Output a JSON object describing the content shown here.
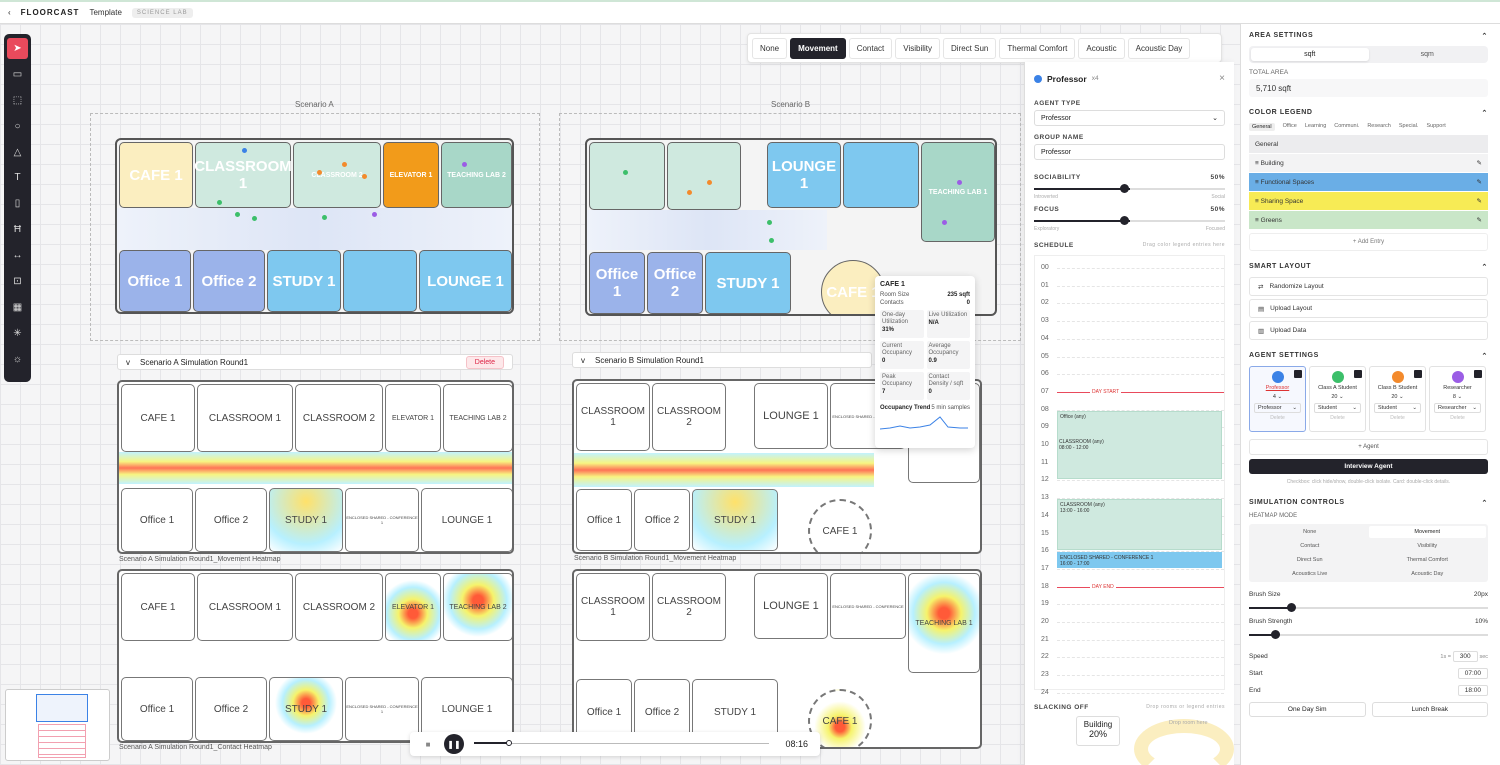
{
  "app": {
    "brand": "FLOORCAST",
    "template": "Template",
    "badge": "SCIENCE LAB"
  },
  "tools": [
    "cursor-icon",
    "rectangle-icon",
    "dashed-rect-icon",
    "circle-icon",
    "triangle-icon",
    "text-icon",
    "door-icon",
    "stairs-icon",
    "dimension-icon",
    "area-select-icon",
    "grid-icon",
    "sparkle-icon",
    "sun-icon"
  ],
  "modes": [
    "None",
    "Movement",
    "Contact",
    "Visibility",
    "Direct Sun",
    "Thermal Comfort",
    "Acoustic",
    "Acoustic Day"
  ],
  "active_mode": "Movement",
  "scenario_a": {
    "label": "Scenario A",
    "rooms": [
      "CAFE 1",
      "CLASSROOM 1",
      "CLASSROOM 2",
      "ELEVATOR 1",
      "TEACHING LAB 2",
      "Office 1",
      "Office 2",
      "STUDY 1",
      "LOUNGE 1"
    ],
    "sim_title": "Scenario A Simulation Round1",
    "delete": "Delete",
    "heatmap_caption": "Scenario A Simulation Round1_Movement Heatmap",
    "contact_caption": "Scenario A Simulation Round1_Contact Heatmap",
    "heat_rooms": [
      "CAFE 1",
      "CLASSROOM 1",
      "CLASSROOM 2",
      "ELEVATOR 1",
      "TEACHING LAB 2",
      "Office 1",
      "Office 2",
      "STUDY 1",
      "ENCLOSED SHARED - CONFERENCE 1",
      "LOUNGE 1"
    ]
  },
  "scenario_b": {
    "label": "Scenario B",
    "rooms": [
      "LOUNGE 1",
      "TEACHING LAB 1",
      "Office 1",
      "Office 2",
      "STUDY 1",
      "CAFE 1"
    ],
    "sim_title": "Scenario B Simulation Round1",
    "heatmap_caption": "Scenario B Simulation Round1_Movement Heatmap",
    "heat_rooms": [
      "CLASSROOM 1",
      "CLASSROOM 2",
      "LOUNGE 1",
      "ENCLOSED SHARED - CONFERENCE",
      "TEACHING LAB 1",
      "Office 1",
      "Office 2",
      "STUDY 1",
      "CAFE 1"
    ]
  },
  "tooltip": {
    "title": "CAFE 1",
    "room_size_label": "Room Size",
    "room_size": "235 sqft",
    "contacts_label": "Contacts",
    "contacts": "0",
    "stats": [
      {
        "label": "One-day Utilization",
        "value": "31%"
      },
      {
        "label": "Live Utilization",
        "value": "N/A"
      },
      {
        "label": "Current Occupancy",
        "value": "0"
      },
      {
        "label": "Average Occupancy",
        "value": "0.9"
      },
      {
        "label": "Peak Occupancy",
        "value": "7"
      },
      {
        "label": "Contact Density / sqft",
        "value": "0"
      }
    ],
    "trend_label": "Occupancy Trend",
    "trend_note": "5 min samples"
  },
  "agent_panel": {
    "name": "Professor",
    "count": "x4",
    "agent_type_label": "AGENT TYPE",
    "agent_type": "Professor",
    "group_label": "GROUP NAME",
    "group": "Professor",
    "sociability_label": "SOCIABILITY",
    "sociability": "50%",
    "soc_left": "Introverted",
    "soc_right": "Social",
    "focus_label": "FOCUS",
    "focus": "50%",
    "focus_left": "Exploratory",
    "focus_right": "Focused",
    "schedule_label": "SCHEDULE",
    "schedule_hint": "Drag color legend entries here",
    "hours": [
      "00",
      "01",
      "02",
      "03",
      "04",
      "05",
      "06",
      "07",
      "08",
      "09",
      "10",
      "11",
      "12",
      "13",
      "14",
      "15",
      "16",
      "17",
      "18",
      "19",
      "20",
      "21",
      "22",
      "23",
      "24"
    ],
    "day_start": "DAY START",
    "day_end": "DAY END",
    "blocks": [
      {
        "title": "Office (any)",
        "time": ""
      },
      {
        "title": "CLASSROOM (any)",
        "time": "08:00 - 12:00"
      },
      {
        "title": "CLASSROOM (any)",
        "time": "13:00 - 16:00"
      },
      {
        "title": "ENCLOSED SHARED - CONFERENCE 1",
        "time": "16:00 - 17:00"
      }
    ],
    "slacking_label": "SLACKING OFF",
    "slacking_hint": "Drop rooms or legend entries",
    "drop_hint": "Drop room here",
    "slack_room": "Building",
    "slack_value": "20%"
  },
  "settings": {
    "area_title": "AREA SETTINGS",
    "units": [
      "sqft",
      "sqm"
    ],
    "total_label": "TOTAL AREA",
    "total": "5,710 sqft",
    "legend_title": "COLOR LEGEND",
    "legend_tabs": [
      "General",
      "Office",
      "Learning",
      "Communi.",
      "Research",
      "Special.",
      "Support"
    ],
    "legend_group": "General",
    "legend_items": [
      {
        "label": "Building",
        "color": "#f3f3f4"
      },
      {
        "label": "Functional Spaces",
        "color": "#6aaee6"
      },
      {
        "label": "Sharing Space",
        "color": "#f7eb55"
      },
      {
        "label": "Greens",
        "color": "#c9e6c8"
      }
    ],
    "add_entry": "+ Add Entry",
    "smart_title": "SMART LAYOUT",
    "smart_items": [
      "Randomize Layout",
      "Upload Layout",
      "Upload Data"
    ],
    "agent_title": "AGENT SETTINGS",
    "agents": [
      {
        "name": "Professor",
        "count": "4",
        "type": "Professor",
        "color": "#3b82e6"
      },
      {
        "name": "Class A Student",
        "count": "20",
        "type": "Student",
        "color": "#3cbf6a"
      },
      {
        "name": "Class B Student",
        "count": "20",
        "type": "Student",
        "color": "#f38a2c"
      },
      {
        "name": "Researcher",
        "count": "8",
        "type": "Researcher",
        "color": "#9b5de5"
      }
    ],
    "agent_delete": "Delete",
    "add_agent": "+ Agent",
    "interview": "Interview Agent",
    "agent_hint": "Checkbox: click hide/show, double-click isolate. Card: double-click details.",
    "sim_title": "SIMULATION CONTROLS",
    "heatmode_label": "HEATMAP MODE",
    "heat_modes": [
      "None",
      "Movement",
      "Contact",
      "Visibility",
      "Direct Sun",
      "Thermal Comfort",
      "Acoustics Live",
      "Acoustic Day"
    ],
    "brush_size_label": "Brush Size",
    "brush_size": "20px",
    "brush_strength_label": "Brush Strength",
    "brush_strength": "10%",
    "speed_label": "Speed",
    "speed_prefix": "1s =",
    "speed": "300",
    "speed_unit": "sec",
    "start_label": "Start",
    "start": "07:00",
    "end_label": "End",
    "end": "18:00",
    "one_day": "One Day Sim",
    "lunch": "Lunch Break"
  },
  "player": {
    "time": "08:16",
    "progress": 0.12
  }
}
